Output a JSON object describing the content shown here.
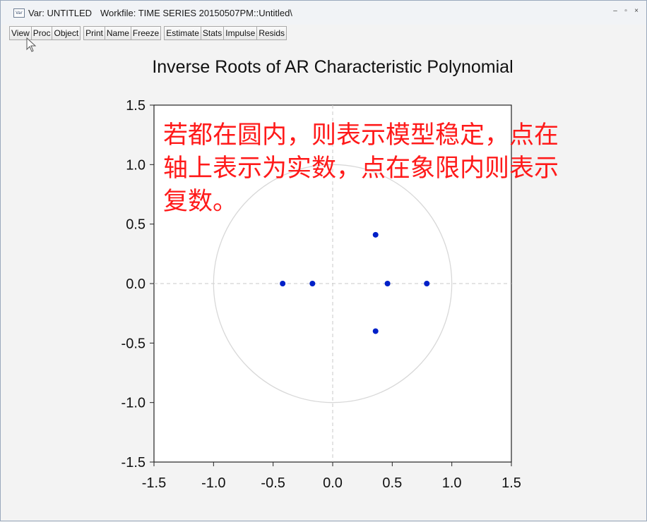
{
  "window": {
    "title": "Var: UNTITLED",
    "workfile": "Workfile: TIME SERIES 20150507PM::Untitled\\",
    "icon": "var-object-icon",
    "controls": [
      "–",
      "▫",
      "×"
    ]
  },
  "toolbar": {
    "buttons": [
      "View",
      "Proc",
      "Object",
      "Print",
      "Name",
      "Freeze",
      "Estimate",
      "Stats",
      "Impulse",
      "Resids"
    ]
  },
  "chart_data": {
    "type": "scatter",
    "title": "Inverse Roots of AR Characteristic Polynomial",
    "xlabel": "",
    "ylabel": "",
    "xlim": [
      -1.5,
      1.5
    ],
    "ylim": [
      -1.5,
      1.5
    ],
    "x_ticks": [
      "-1.5",
      "-1.0",
      "-0.5",
      "0.0",
      "0.5",
      "1.0",
      "1.5"
    ],
    "y_ticks": [
      "1.5",
      "1.0",
      "0.5",
      "0.0",
      "-0.5",
      "-1.0",
      "-1.5"
    ],
    "unit_circle": true,
    "zero_lines": true,
    "point_color": "#0020c8",
    "points": [
      {
        "x": -0.42,
        "y": 0.0
      },
      {
        "x": -0.17,
        "y": 0.0
      },
      {
        "x": 0.36,
        "y": 0.41
      },
      {
        "x": 0.36,
        "y": -0.4
      },
      {
        "x": 0.46,
        "y": 0.0
      },
      {
        "x": 0.79,
        "y": 0.0
      }
    ]
  },
  "annotation": {
    "text": "若都在圆内，则表示模型稳定，点在轴上表示为实数，点在象限内则表示复数。",
    "color": "#ff1a1a"
  }
}
